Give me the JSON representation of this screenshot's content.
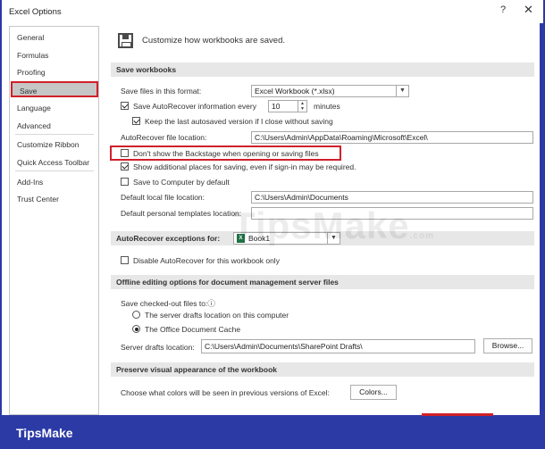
{
  "window": {
    "title": "Excel Options",
    "help_glyph": "?",
    "close_glyph": "✕"
  },
  "sidebar": {
    "items": [
      {
        "label": "General"
      },
      {
        "label": "Formulas"
      },
      {
        "label": "Proofing"
      },
      {
        "label": "Save",
        "selected": true
      },
      {
        "label": "Language"
      },
      {
        "label": "Advanced"
      },
      {
        "label": "Customize Ribbon"
      },
      {
        "label": "Quick Access Toolbar"
      },
      {
        "label": "Add-Ins"
      },
      {
        "label": "Trust Center"
      }
    ]
  },
  "header": {
    "icon": "save-icon",
    "text": "Customize how workbooks are saved."
  },
  "save_workbooks": {
    "title": "Save workbooks",
    "format_label": "Save files in this format:",
    "format_value": "Excel Workbook (*.xlsx)",
    "autorecover_label": "Save AutoRecover information every",
    "autorecover_checked": true,
    "autorecover_minutes": "10",
    "minutes_label": "minutes",
    "keep_label": "Keep the last autosaved version if I close without saving",
    "keep_checked": true,
    "location_label": "AutoRecover file location:",
    "location_value": "C:\\Users\\Admin\\AppData\\Roaming\\Microsoft\\Excel\\",
    "backstage_label": "Don't show the Backstage when opening or saving files",
    "backstage_checked": false,
    "additional_label": "Show additional places for saving, even if sign-in may be required.",
    "additional_checked": true,
    "computer_label": "Save to Computer by default",
    "computer_checked": false,
    "default_local_label": "Default local file location:",
    "default_local_value": "C:\\Users\\Admin\\Documents",
    "templates_label": "Default personal templates location:",
    "templates_value": ""
  },
  "autorecover_exceptions": {
    "title": "AutoRecover exceptions for:",
    "workbook": "Book1",
    "disable_label": "Disable AutoRecover for this workbook only",
    "disable_checked": false
  },
  "offline": {
    "title": "Offline editing options for document management server files",
    "checked_out_label": "Save checked-out files to:",
    "info_glyph": "ⓘ",
    "option_server": "The server drafts location on this computer",
    "option_cache": "The Office Document Cache",
    "selected": "cache",
    "server_drafts_label": "Server drafts location:",
    "server_drafts_value": "C:\\Users\\Admin\\Documents\\SharePoint Drafts\\",
    "browse_label": "Browse..."
  },
  "preserve": {
    "title": "Preserve visual appearance of the workbook",
    "colors_question": "Choose what colors will be seen in previous versions of Excel:",
    "colors_button": "Colors..."
  },
  "watermark": "TipsMake",
  "watermark_suffix": ".com",
  "brand": "TipsMake",
  "colors": {
    "accent_frame": "#2c3aa6",
    "highlight": "#d0202a",
    "section_bg": "#e7e7e7",
    "excel_green": "#1f7244"
  }
}
